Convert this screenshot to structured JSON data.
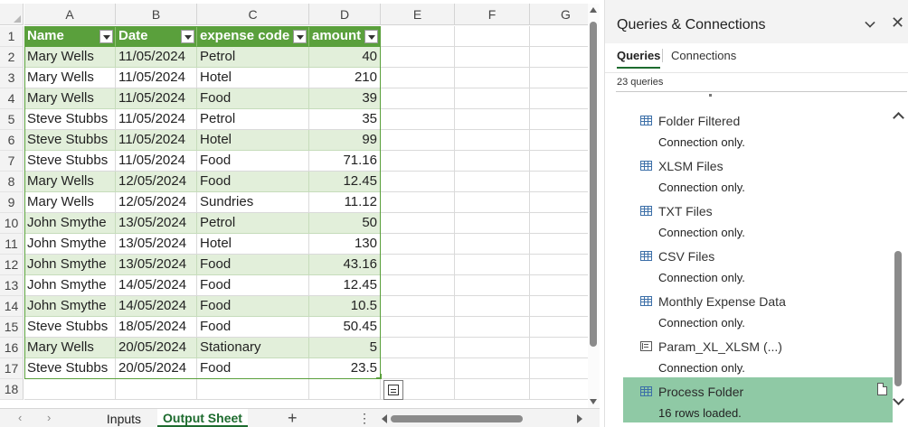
{
  "sheet": {
    "columns": [
      "A",
      "B",
      "C",
      "D",
      "E",
      "F",
      "G"
    ],
    "rows": [
      "1",
      "2",
      "3",
      "4",
      "5",
      "6",
      "7",
      "8",
      "9",
      "10",
      "11",
      "12",
      "13",
      "14",
      "15",
      "16",
      "17",
      "18"
    ],
    "table": {
      "headers": [
        "Name",
        "Date",
        "expense code",
        "amount"
      ],
      "data": [
        [
          "Mary Wells",
          "11/05/2024",
          "Petrol",
          "40"
        ],
        [
          "Mary Wells",
          "11/05/2024",
          "Hotel",
          "210"
        ],
        [
          "Mary Wells",
          "11/05/2024",
          "Food",
          "39"
        ],
        [
          "Steve Stubbs",
          "11/05/2024",
          "Petrol",
          "35"
        ],
        [
          "Steve Stubbs",
          "11/05/2024",
          "Hotel",
          "99"
        ],
        [
          "Steve Stubbs",
          "11/05/2024",
          "Food",
          "71.16"
        ],
        [
          "Mary Wells",
          "12/05/2024",
          "Food",
          "12.45"
        ],
        [
          "Mary Wells",
          "12/05/2024",
          "Sundries",
          "11.12"
        ],
        [
          "John Smythe",
          "13/05/2024",
          "Petrol",
          "50"
        ],
        [
          "John Smythe",
          "13/05/2024",
          "Hotel",
          "130"
        ],
        [
          "John Smythe",
          "13/05/2024",
          "Food",
          "43.16"
        ],
        [
          "John Smythe",
          "14/05/2024",
          "Food",
          "12.45"
        ],
        [
          "John Smythe",
          "14/05/2024",
          "Food",
          "10.5"
        ],
        [
          "Steve Stubbs",
          "18/05/2024",
          "Food",
          "50.45"
        ],
        [
          "Mary Wells",
          "20/05/2024",
          "Stationary",
          "5"
        ],
        [
          "Steve Stubbs",
          "20/05/2024",
          "Food",
          "23.5"
        ]
      ]
    },
    "tabs": [
      {
        "label": "Inputs",
        "active": false
      },
      {
        "label": "Output Sheet",
        "active": true
      }
    ],
    "add_sheet_label": "+",
    "more_label": "⋮",
    "nav_prev_label": "‹",
    "nav_next_label": "›"
  },
  "pane": {
    "title": "Queries & Connections",
    "close_label": "✕",
    "tabs": [
      {
        "label": "Queries",
        "active": true
      },
      {
        "label": "Connections",
        "active": false
      }
    ],
    "query_count": "23 queries",
    "queries": [
      {
        "name": "Folder Filtered",
        "status": "Connection only.",
        "icon": "table-icon",
        "selected": false
      },
      {
        "name": "XLSM Files",
        "status": "Connection only.",
        "icon": "table-icon",
        "selected": false
      },
      {
        "name": "TXT Files",
        "status": "Connection only.",
        "icon": "table-icon",
        "selected": false
      },
      {
        "name": "CSV Files",
        "status": "Connection only.",
        "icon": "table-icon",
        "selected": false
      },
      {
        "name": "Monthly Expense Data",
        "status": "Connection only.",
        "icon": "table-icon",
        "selected": false
      },
      {
        "name": "Param_XL_XLSM (...)",
        "status": "Connection only.",
        "icon": "parameter-icon",
        "selected": false
      },
      {
        "name": "Process Folder",
        "status": "16 rows loaded.",
        "icon": "table-icon",
        "selected": true
      }
    ]
  },
  "colors": {
    "table_header": "#5aa03c",
    "band": "#e2efda",
    "selected_query": "#8fc9a5",
    "active_tab": "#1d6b2e"
  }
}
